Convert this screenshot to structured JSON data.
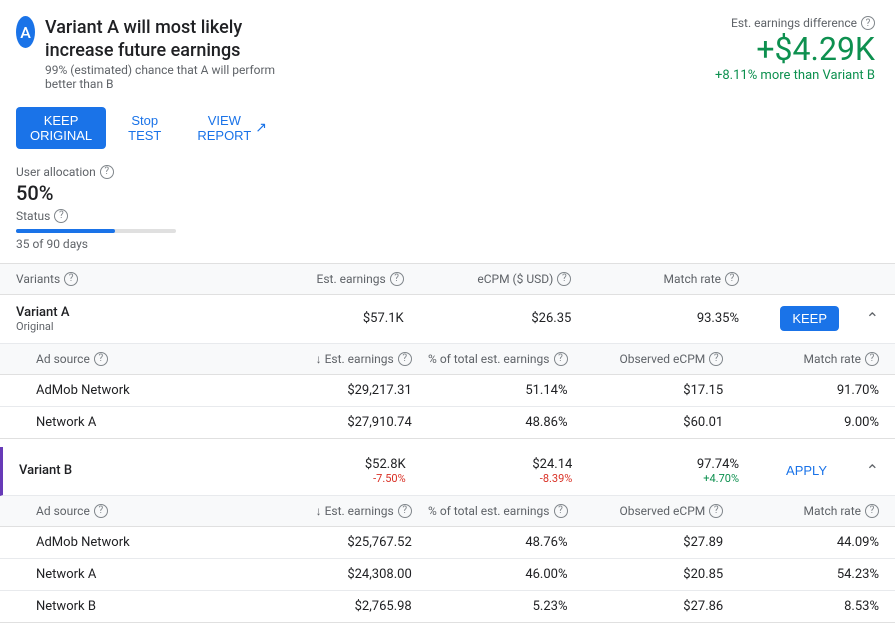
{
  "header": {
    "avatar_letter": "A",
    "title": "Variant A will most likely increase future earnings",
    "subtitle": "99% (estimated) chance that A will perform better than B",
    "buttons": {
      "keep": "KEEP ORIGINAL",
      "stop": "Stop TEST",
      "view": "VIEW REPORT"
    }
  },
  "left_panel": {
    "allocation_label": "User allocation",
    "allocation_value": "50%",
    "status_label": "Status",
    "days_text": "35 of 90 days",
    "progress_percent": 62
  },
  "est_diff": {
    "label": "Est. earnings difference",
    "value": "+$4.29K",
    "sub": "+8.11% more than Variant B"
  },
  "table_headers": {
    "variants": "Variants",
    "est_earnings": "Est. earnings",
    "ecpm": "eCPM ($ USD)",
    "match_rate": "Match rate",
    "action": ""
  },
  "variants": [
    {
      "name": "Variant A",
      "sub": "Original",
      "est_earnings": "$57.1K",
      "est_earnings_sub": "",
      "ecpm": "$26.35",
      "ecpm_sub": "",
      "match_rate": "93.35%",
      "match_rate_sub": "",
      "action": "KEEP",
      "action_type": "keep",
      "inner_rows": [
        {
          "source": "AdMob Network",
          "est_earnings": "$29,217.31",
          "pct_total": "51.14%",
          "observed_ecpm": "$17.15",
          "match_rate": "91.70%"
        },
        {
          "source": "Network A",
          "est_earnings": "$27,910.74",
          "pct_total": "48.86%",
          "observed_ecpm": "$60.01",
          "match_rate": "9.00%"
        }
      ]
    },
    {
      "name": "Variant B",
      "sub": "",
      "est_earnings": "$52.8K",
      "est_earnings_sub": "-7.50%",
      "ecpm": "$24.14",
      "ecpm_sub": "-8.39%",
      "match_rate": "97.74%",
      "match_rate_sub": "+4.70%",
      "action": "APPLY",
      "action_type": "apply",
      "inner_rows": [
        {
          "source": "AdMob Network",
          "est_earnings": "$25,767.52",
          "pct_total": "48.76%",
          "observed_ecpm": "$27.89",
          "match_rate": "44.09%"
        },
        {
          "source": "Network A",
          "est_earnings": "$24,308.00",
          "pct_total": "46.00%",
          "observed_ecpm": "$20.85",
          "match_rate": "54.23%"
        },
        {
          "source": "Network B",
          "est_earnings": "$2,765.98",
          "pct_total": "5.23%",
          "observed_ecpm": "$27.86",
          "match_rate": "8.53%"
        }
      ]
    }
  ],
  "inner_headers": {
    "ad_source": "Ad source",
    "est_earnings": "↓ Est. earnings",
    "pct_total": "% of total est. earnings",
    "observed_ecpm": "Observed eCPM",
    "match_rate": "Match rate"
  }
}
